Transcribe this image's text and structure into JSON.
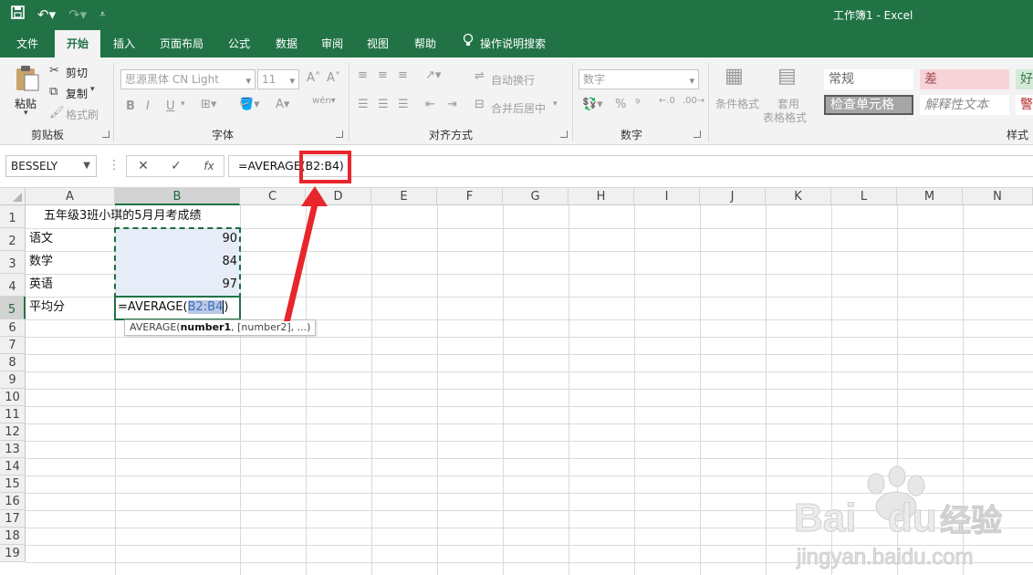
{
  "window": {
    "title": "工作簿1  -  Excel"
  },
  "qat": {
    "save_icon": "save-icon",
    "undo_icon": "undo-icon",
    "redo_icon": "redo-icon",
    "customize_icon": "customize-qat-icon"
  },
  "tabs": [
    "文件",
    "开始",
    "插入",
    "页面布局",
    "公式",
    "数据",
    "审阅",
    "视图",
    "帮助"
  ],
  "tell_me": "操作说明搜索",
  "ribbon": {
    "clipboard": {
      "paste": "粘贴",
      "cut": "剪切",
      "copy": "复制",
      "format_painter": "格式刷",
      "label": "剪贴板"
    },
    "font": {
      "name": "思源黑体 CN Light",
      "size": "11",
      "label": "字体",
      "bold": "B",
      "italic": "I",
      "underline": "U"
    },
    "alignment": {
      "wrap": "自动换行",
      "merge": "合并后居中",
      "label": "对齐方式"
    },
    "number": {
      "format": "数字",
      "label": "数字",
      "percent": "%"
    },
    "styles": {
      "conditional": "条件格式",
      "table1": "套用",
      "table2": "表格格式",
      "normal": "常规",
      "bad": "差",
      "good": "好",
      "check": "检查单元格",
      "explanatory": "解释性文本",
      "warning": "警",
      "label": "样式"
    }
  },
  "formula_bar": {
    "name_box": "BESSELY",
    "formula": "=AVERAGE(B2:B4)",
    "fx": "fx"
  },
  "columns": [
    "A",
    "B",
    "C",
    "D",
    "E",
    "F",
    "G",
    "H",
    "I",
    "J",
    "K",
    "L",
    "M",
    "N"
  ],
  "rows": [
    "1",
    "2",
    "3",
    "4",
    "5",
    "6",
    "7",
    "8",
    "9",
    "10",
    "11",
    "12",
    "13",
    "14",
    "15",
    "16",
    "17",
    "18",
    "19"
  ],
  "cells": {
    "a1": "五年级3班小琪的5月月考成绩",
    "a2": "语文",
    "b2": "90",
    "a3": "数学",
    "b3": "84",
    "a4": "英语",
    "b4": "97",
    "a5": "平均分",
    "b5_prefix": "=AVERAGE(",
    "b5_ref": "B2:B4",
    "b5_suffix": ")"
  },
  "tooltip": {
    "func": "AVERAGE(",
    "arg1": "number1",
    "rest": ", [number2], ...)"
  },
  "colors": {
    "excel_green": "#217346",
    "annotation_red": "#e8262b"
  }
}
